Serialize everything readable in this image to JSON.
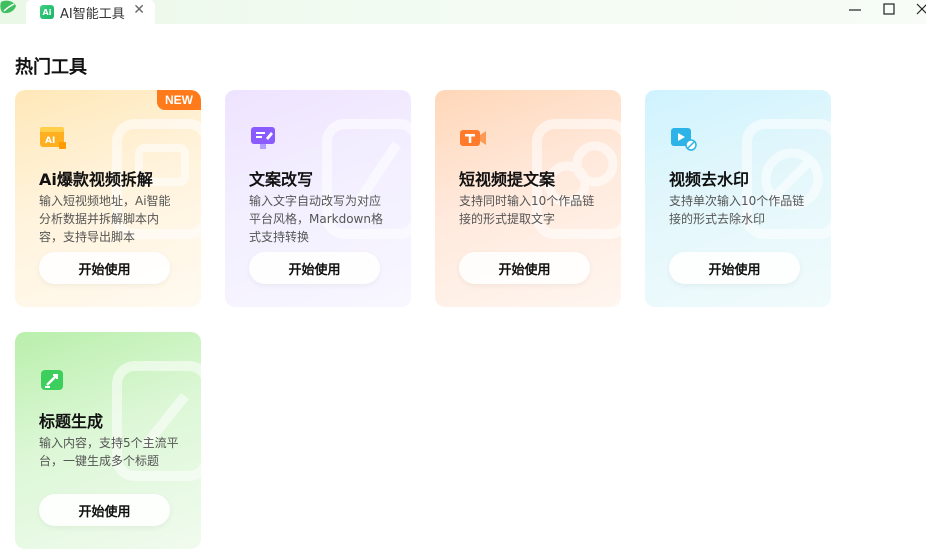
{
  "window": {
    "tab_title": "AI智能工具",
    "tab_icon_text": "Ai"
  },
  "section": {
    "title": "热门工具"
  },
  "colors": {
    "badge": "#ff7a1a",
    "brand_green": "#2fbf6e"
  },
  "cards": [
    {
      "title": "Ai爆款视频拆解",
      "desc": "输入短视频地址，Ai智能分析数据并拆解脚本内容，支持导出脚本",
      "button": "开始使用",
      "badge": "NEW",
      "icon": "ai-video-icon"
    },
    {
      "title": "文案改写",
      "desc": "输入文字自动改写为对应平台风格，Markdown格式支持转换",
      "button": "开始使用",
      "icon": "rewrite-icon"
    },
    {
      "title": "短视频提文案",
      "desc": "支持同时输入10个作品链接的形式提取文字",
      "button": "开始使用",
      "icon": "extract-text-icon"
    },
    {
      "title": "视频去水印",
      "desc": "支持单次输入10个作品链接的形式去除水印",
      "button": "开始使用",
      "icon": "remove-watermark-icon"
    },
    {
      "title": "标题生成",
      "desc": "输入内容，支持5个主流平台，一键生成多个标题",
      "button": "开始使用",
      "icon": "title-generate-icon"
    }
  ]
}
